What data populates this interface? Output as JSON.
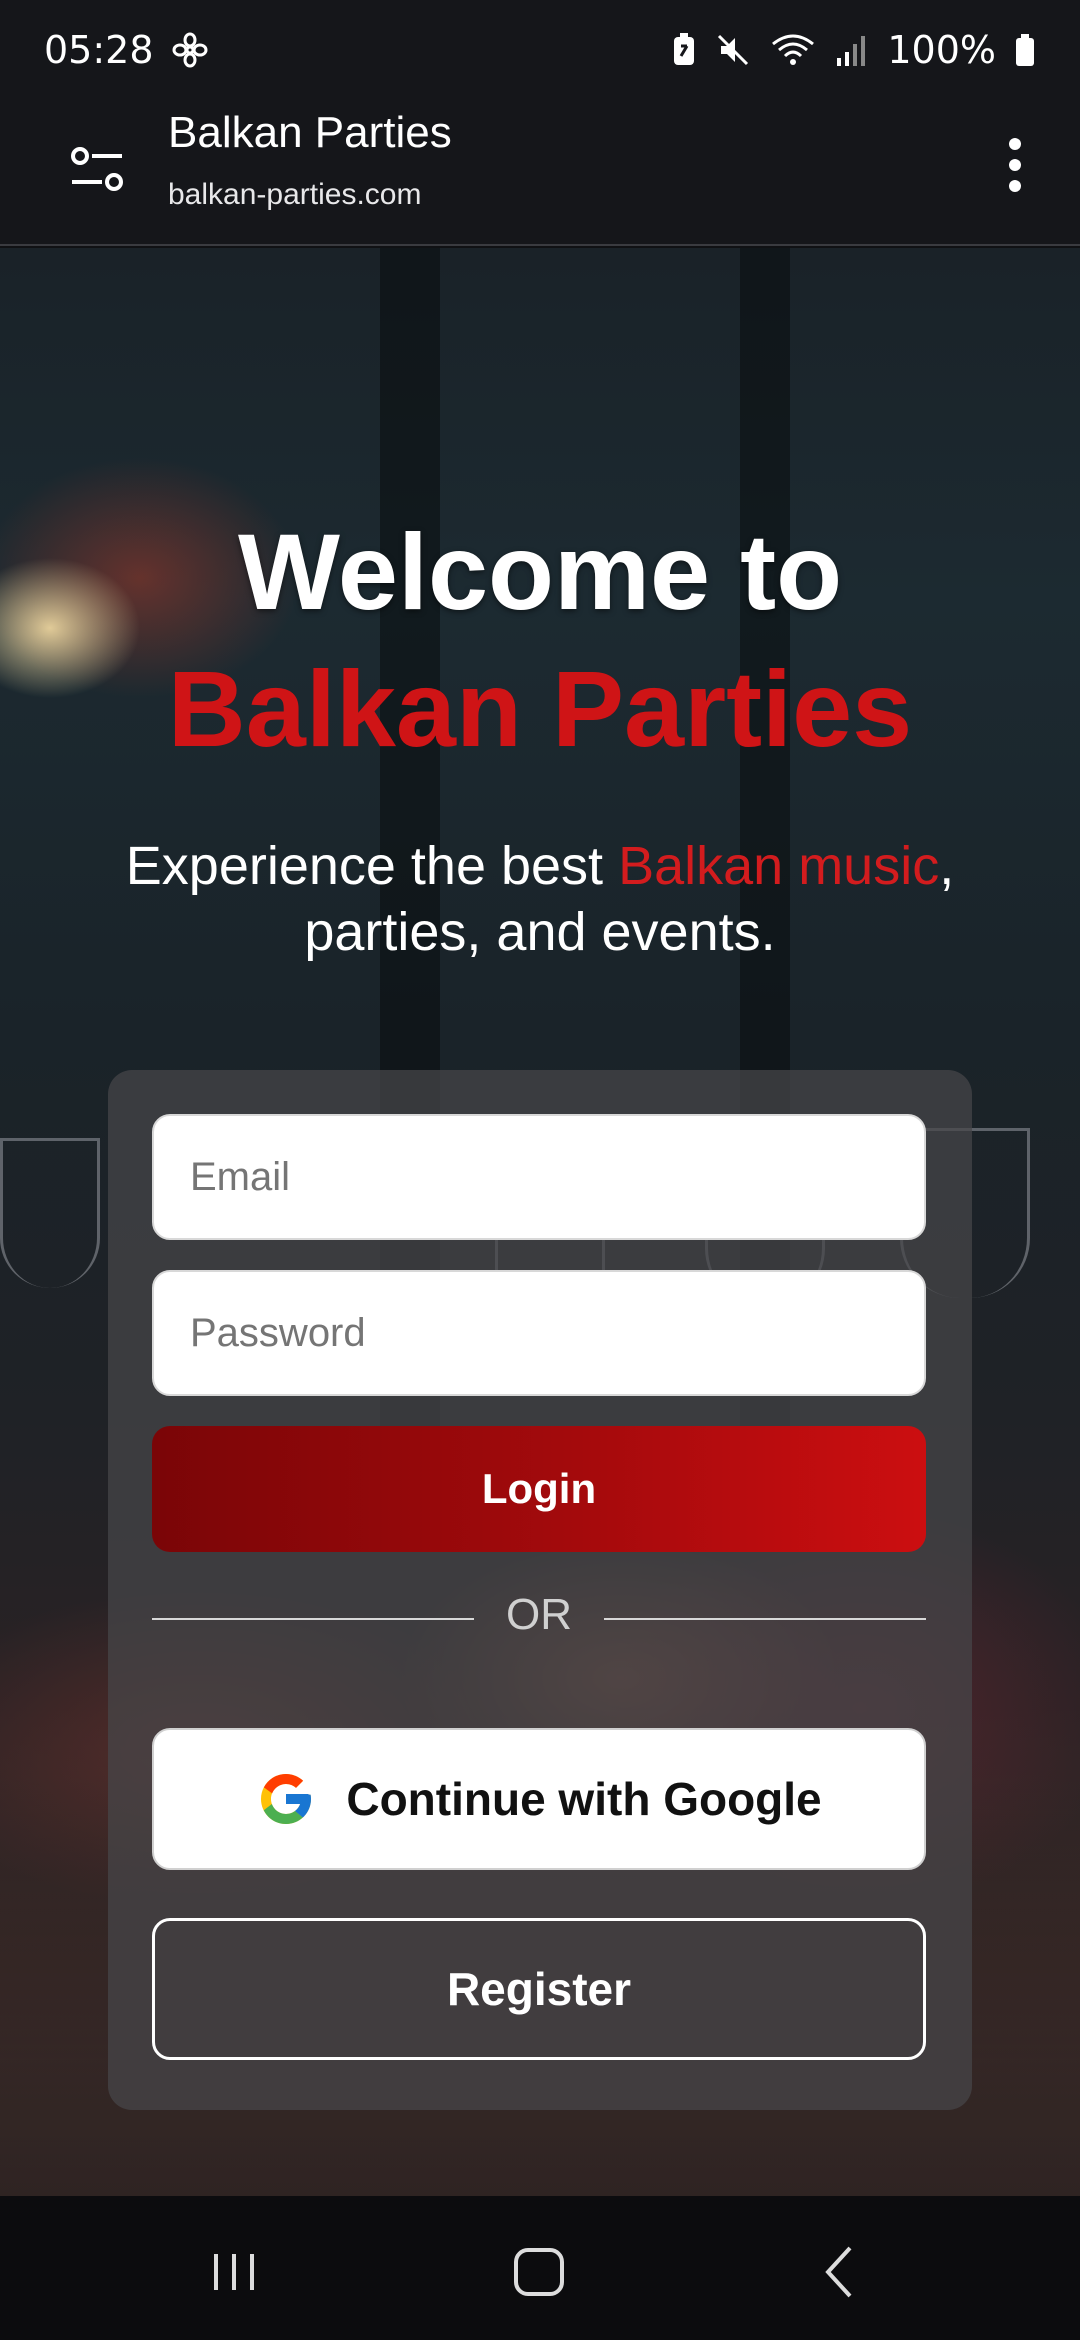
{
  "status_bar": {
    "time": "05:28",
    "battery": "100%",
    "icons": [
      "fan-icon",
      "battery-saver-icon",
      "mute-icon",
      "wifi-icon",
      "signal-icon",
      "battery-icon"
    ]
  },
  "browser": {
    "site_title": "Balkan Parties",
    "site_url": "balkan-parties.com",
    "icons": [
      "tune-icon",
      "more-vert-icon"
    ]
  },
  "hero": {
    "title_line1": "Welcome to",
    "title_line2": "Balkan Parties",
    "subtitle_pre": "Experience the best ",
    "subtitle_accent": "Balkan music",
    "subtitle_post": ", parties, and events."
  },
  "login_form": {
    "email_placeholder": "Email",
    "email_value": "",
    "password_placeholder": "Password",
    "password_value": "",
    "login_label": "Login",
    "or_label": "OR",
    "google_label": "Continue with Google",
    "register_label": "Register"
  },
  "colors": {
    "accent_red": "#cf1416",
    "login_gradient_start": "#7a0507",
    "login_gradient_end": "#cc0e10",
    "background": "#101114"
  },
  "nav": {
    "icons": [
      "recents-icon",
      "home-icon",
      "back-icon"
    ]
  }
}
